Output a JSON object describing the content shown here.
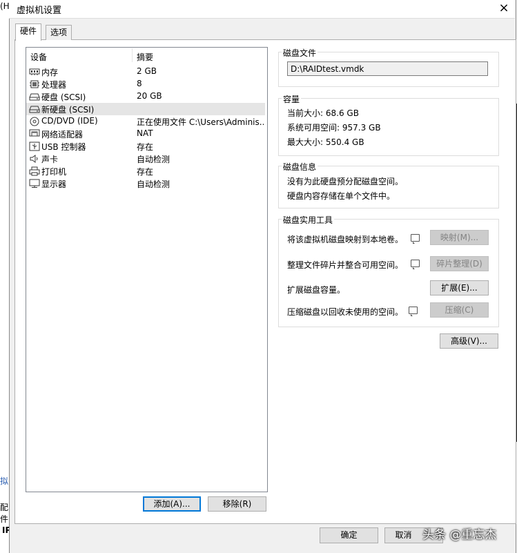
{
  "window": {
    "title": "虚拟机设置",
    "close_label": "×"
  },
  "background": {
    "frag_top": "(H)",
    "frag_a": "拟",
    "frag_b": "配",
    "frag_c": "件",
    "frag_d": "IP"
  },
  "tabs": [
    {
      "label": "硬件"
    },
    {
      "label": "选项"
    }
  ],
  "device_list": {
    "col_device": "设备",
    "col_summary": "摘要",
    "rows": [
      {
        "name": "内存",
        "summary": "2 GB",
        "icon": "memory-icon"
      },
      {
        "name": "处理器",
        "summary": "8",
        "icon": "cpu-icon"
      },
      {
        "name": "硬盘 (SCSI)",
        "summary": "20 GB",
        "icon": "harddisk-icon"
      },
      {
        "name": "新硬盘 (SCSI)",
        "summary": "",
        "icon": "harddisk-icon"
      },
      {
        "name": "CD/DVD (IDE)",
        "summary": "正在使用文件 C:\\Users\\Adminis...",
        "icon": "cd-icon"
      },
      {
        "name": "网络适配器",
        "summary": "NAT",
        "icon": "network-icon"
      },
      {
        "name": "USB 控制器",
        "summary": "存在",
        "icon": "usb-icon"
      },
      {
        "name": "声卡",
        "summary": "自动检测",
        "icon": "speaker-icon"
      },
      {
        "name": "打印机",
        "summary": "存在",
        "icon": "printer-icon"
      },
      {
        "name": "显示器",
        "summary": "自动检测",
        "icon": "monitor-icon"
      }
    ],
    "add_label": "添加(A)...",
    "remove_label": "移除(R)"
  },
  "disk_file": {
    "title": "磁盘文件",
    "path": "D:\\RAIDtest.vmdk"
  },
  "capacity": {
    "title": "容量",
    "current": "当前大小: 68.6 GB",
    "available": "系统可用空间: 957.3 GB",
    "max": "最大大小: 550.4 GB"
  },
  "disk_info": {
    "title": "磁盘信息",
    "line1": "没有为此硬盘预分配磁盘空间。",
    "line2": "硬盘内容存储在单个文件中。"
  },
  "utilities": {
    "title": "磁盘实用工具",
    "map_text": "将该虚拟机磁盘映射到本地卷。",
    "map_label": "映射(M)...",
    "defrag_text": "整理文件碎片并整合可用空间。",
    "defrag_label": "碎片整理(D)",
    "expand_text": "扩展磁盘容量。",
    "expand_label": "扩展(E)...",
    "compact_text": "压缩磁盘以回收未使用的空间。",
    "compact_label": "压缩(C)"
  },
  "advanced_label": "高级(V)...",
  "footer": {
    "ok_label": "确定",
    "cancel_label": "取消"
  },
  "watermark": "头条 @重忘杰"
}
